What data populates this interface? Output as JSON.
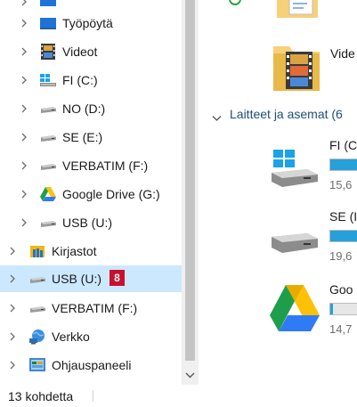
{
  "navigation": {
    "items": [
      {
        "label": "",
        "icon": "desktop-icon",
        "level": 2
      },
      {
        "label": "Työpöytä",
        "icon": "desktop-icon",
        "level": 2
      },
      {
        "label": "Videot",
        "icon": "video-icon",
        "level": 2
      },
      {
        "label": "FI (C:)",
        "icon": "windows-drive-icon",
        "level": 2
      },
      {
        "label": "NO (D:)",
        "icon": "drive-icon",
        "level": 2
      },
      {
        "label": "SE (E:)",
        "icon": "drive-icon",
        "level": 2
      },
      {
        "label": "VERBATIM (F:)",
        "icon": "drive-icon",
        "level": 2
      },
      {
        "label": "Google Drive (G:)",
        "icon": "google-drive-icon",
        "level": 2
      },
      {
        "label": "USB (U:)",
        "icon": "drive-icon",
        "level": 2
      },
      {
        "label": "Kirjastot",
        "icon": "libraries-icon",
        "level": 1
      },
      {
        "label": "USB (U:)",
        "icon": "drive-icon",
        "level": 1,
        "selected": true,
        "badge": "8"
      },
      {
        "label": "VERBATIM (F:)",
        "icon": "drive-icon",
        "level": 1
      },
      {
        "label": "Verkko",
        "icon": "network-icon",
        "level": 1
      },
      {
        "label": "Ohjauspaneeli",
        "icon": "control-panel-icon",
        "level": 1
      }
    ]
  },
  "content": {
    "folders": [
      {
        "label": "",
        "icon": "document-folder-icon"
      },
      {
        "label": "Vide",
        "icon": "videos-folder-icon"
      }
    ],
    "section_title": "Laitteet ja asemat (6",
    "drives": [
      {
        "name": "FI (C",
        "free": "15,6",
        "icon": "windows-drive-icon",
        "used_fraction": 0.9
      },
      {
        "name": "SE (I",
        "free": "19,6",
        "icon": "drive-icon",
        "used_fraction": 0.9
      },
      {
        "name": "Goo",
        "free": "14,7",
        "icon": "google-drive-icon",
        "used_fraction": 0.05
      }
    ]
  },
  "status": {
    "item_count": "13 kohdetta"
  },
  "colors": {
    "selection": "#cce8ff",
    "accent": "#26a0da",
    "badge": "#c8102e"
  }
}
